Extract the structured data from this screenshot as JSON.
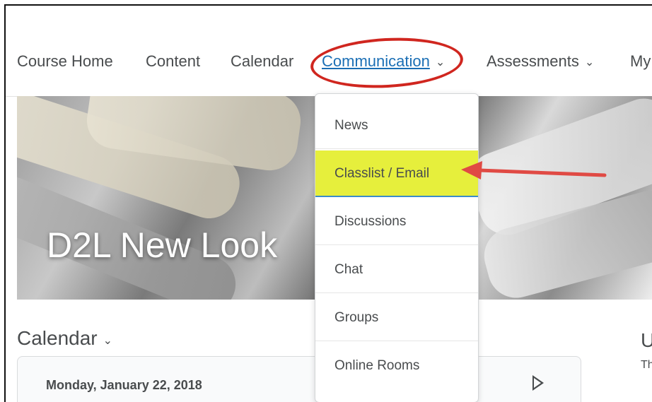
{
  "nav": {
    "items": [
      "Course Home",
      "Content",
      "Calendar",
      "Communication",
      "Assessments",
      "My"
    ]
  },
  "hero": {
    "title": "D2L New Look"
  },
  "dropdown": {
    "items": [
      "News",
      "Classlist / Email",
      "Discussions",
      "Chat",
      "Groups",
      "Online Rooms"
    ],
    "highlight_color": "#e6ef3c"
  },
  "calendar": {
    "heading": "Calendar",
    "date": "Monday, January 22, 2018"
  },
  "right_panel": {
    "heading_partial": "U",
    "sub_partial": "Th"
  },
  "annotations": {
    "circle_color": "#d0261f",
    "arrow_color": "#e04a44"
  },
  "accent_color": "#1b6fb5"
}
